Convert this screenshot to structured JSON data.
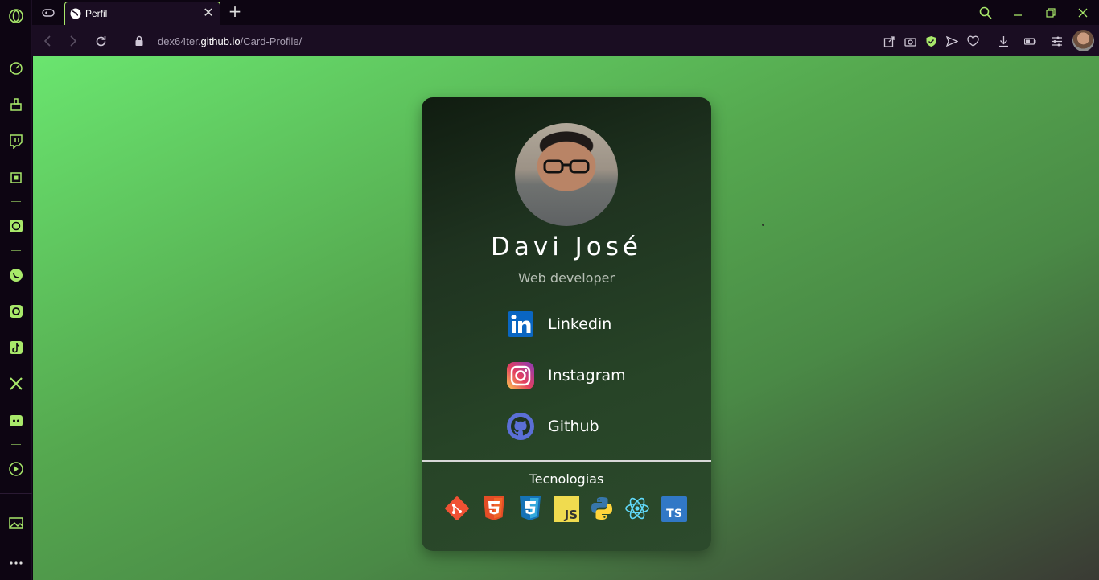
{
  "browser": {
    "tab": {
      "title": "Perfil"
    },
    "address": {
      "url_prefix": "dex64ter.",
      "url_host": "github.io",
      "url_path": "/Card-Profile/"
    }
  },
  "profile": {
    "name": "Davi José",
    "role": "Web developer",
    "links": [
      {
        "label": "Linkedin",
        "icon": "linkedin-icon"
      },
      {
        "label": "Instagram",
        "icon": "instagram-icon"
      },
      {
        "label": "Github",
        "icon": "github-icon"
      }
    ],
    "tech_title": "Tecnologias",
    "techs": [
      "git-icon",
      "html5-icon",
      "css3-icon",
      "javascript-icon",
      "python-icon",
      "react-icon",
      "typescript-icon"
    ]
  },
  "colors": {
    "accent": "#a8e86a",
    "bg_dark": "#0d0512",
    "bar": "#1a0d22"
  }
}
